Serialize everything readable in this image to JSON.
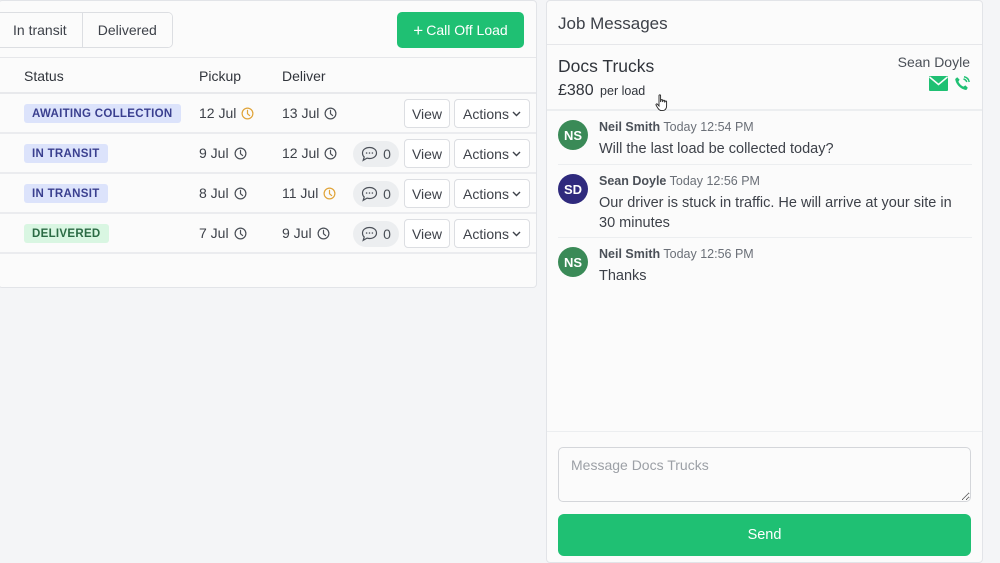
{
  "jobs_panel": {
    "filters": [
      {
        "label": "In transit"
      },
      {
        "label": "Delivered"
      }
    ],
    "call_off_button": {
      "label": "Call Off Load",
      "icon": "plus-icon"
    },
    "columns": {
      "status": "Status",
      "pickup": "Pickup",
      "deliver": "Deliver"
    },
    "rows": [
      {
        "status": "AWAITING COLLECTION",
        "status_type": "awaiting",
        "pickup": "12 Jul",
        "pickup_clock": "warning",
        "deliver": "13 Jul",
        "deliver_clock": "normal",
        "messages": null,
        "view": "View",
        "actions": "Actions"
      },
      {
        "status": "IN TRANSIT",
        "status_type": "transit",
        "pickup": "9 Jul",
        "pickup_clock": "normal",
        "deliver": "12 Jul",
        "deliver_clock": "normal",
        "messages": "0",
        "view": "View",
        "actions": "Actions"
      },
      {
        "status": "IN TRANSIT",
        "status_type": "transit",
        "pickup": "8 Jul",
        "pickup_clock": "normal",
        "deliver": "11 Jul",
        "deliver_clock": "warning",
        "messages": "0",
        "view": "View",
        "actions": "Actions"
      },
      {
        "status": "DELIVERED",
        "status_type": "delivered",
        "pickup": "7 Jul",
        "pickup_clock": "normal",
        "deliver": "9 Jul",
        "deliver_clock": "normal",
        "messages": "0",
        "view": "View",
        "actions": "Actions"
      }
    ]
  },
  "messages_panel": {
    "title": "Job Messages",
    "company": "Docs Trucks",
    "price": "£380",
    "price_unit": "per load",
    "contact_name": "Sean Doyle",
    "contact_icons": [
      "email-icon",
      "phone-icon"
    ],
    "messages": [
      {
        "initials": "NS",
        "author": "Neil Smith",
        "time": "Today 12:54 PM",
        "text": "Will the last load be collected today?",
        "avatar_color": "#3a8a57"
      },
      {
        "initials": "SD",
        "author": "Sean Doyle",
        "time": "Today 12:56 PM",
        "text": "Our driver is stuck in traffic. He will arrive at your site in 30 minutes",
        "avatar_color": "#2f2a7d"
      },
      {
        "initials": "NS",
        "author": "Neil Smith",
        "time": "Today 12:56 PM",
        "text": "Thanks",
        "avatar_color": "#3a8a57"
      }
    ],
    "input": {
      "value": "",
      "placeholder": "Message Docs Trucks"
    },
    "send_label": "Send"
  },
  "colors": {
    "accent": "#1fc073",
    "clock_normal": "#4b5058",
    "clock_warning": "#e0a43a"
  }
}
